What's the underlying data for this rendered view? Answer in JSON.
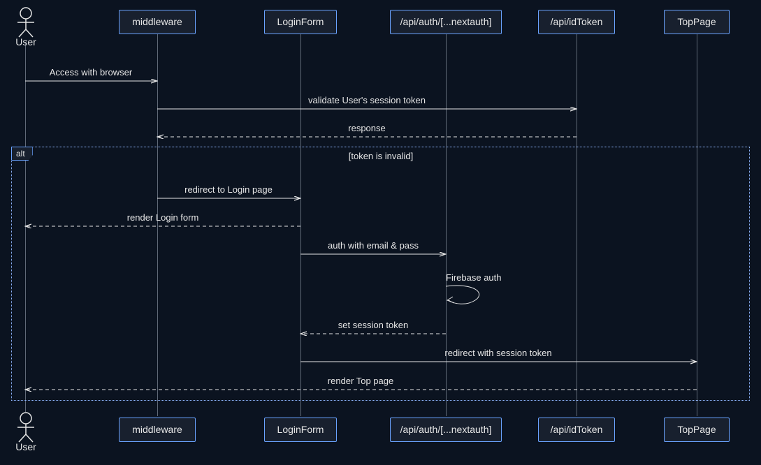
{
  "actor": {
    "name": "User"
  },
  "participants": {
    "middleware": "middleware",
    "loginform": "LoginForm",
    "apiauth": "/api/auth/[...nextauth]",
    "apiidtoken": "/api/idToken",
    "toppage": "TopPage"
  },
  "alt": {
    "tag": "alt",
    "condition": "[token is invalid]"
  },
  "messages": {
    "m1": "Access with browser",
    "m2": "validate User's session token",
    "m3": "response",
    "m4": "redirect to Login page",
    "m5": "render Login form",
    "m6": "auth with email & pass",
    "m7": "Firebase auth",
    "m8": "set session token",
    "m9": "redirect with session token",
    "m10": "render Top page"
  },
  "lanes": {
    "user": 36,
    "middleware": 225,
    "loginform": 430,
    "apiauth": 638,
    "apiidtoken": 825,
    "toppage": 997
  }
}
